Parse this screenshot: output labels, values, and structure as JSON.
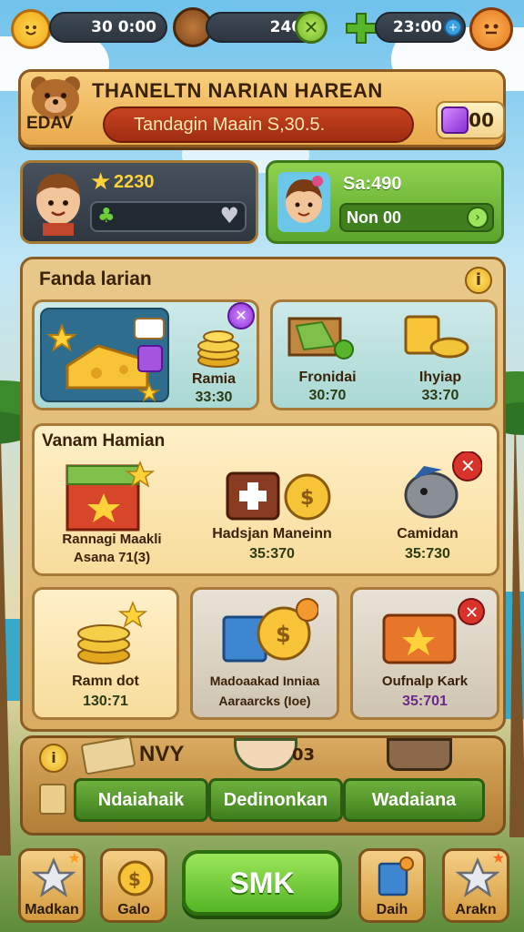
{
  "topbar": {
    "resource1": "30 0:00",
    "resource2": "2400",
    "resource3": "23:00"
  },
  "header": {
    "title": "THANELTN NARIAN HAREAN",
    "subtitle": "Tandagin Maain S,30.5.",
    "tag": "EDAV",
    "count": "00"
  },
  "player": {
    "stars": "2230",
    "friend_value": "Sa:490",
    "friend_sub": "Non 00"
  },
  "shop": {
    "title": "Fanda larian",
    "row1": [
      {
        "label": "Ramia",
        "price": "33:30"
      },
      {
        "label": "Fronidai",
        "price": "30:70"
      },
      {
        "label": "Ihyiap",
        "price": "33:70"
      }
    ],
    "section2_title": "Vanam Hamian",
    "row2": [
      {
        "label": "Rannagi Maakli",
        "sub": "Asana 71(3)"
      },
      {
        "label": "Hadsjan Maneinn",
        "price": "35:370"
      },
      {
        "label": "Camidan",
        "price": "35:730"
      }
    ],
    "row3": [
      {
        "label": "Ramn dot",
        "price": "130:71"
      },
      {
        "label": "Madoaakad Inniaa",
        "sub": "Aaraarcks (Ioe)"
      },
      {
        "label": "Oufnalp Kark",
        "price": "35:701"
      }
    ]
  },
  "strip": {
    "label": "NVY",
    "badge": "03",
    "buttons": [
      "Ndaiahaik",
      "Dedinonkan",
      "Wadaiana"
    ]
  },
  "bottom_nav": {
    "items": [
      "Madkan",
      "Galo",
      "Daih",
      "Arakn"
    ],
    "main": "SMK"
  }
}
